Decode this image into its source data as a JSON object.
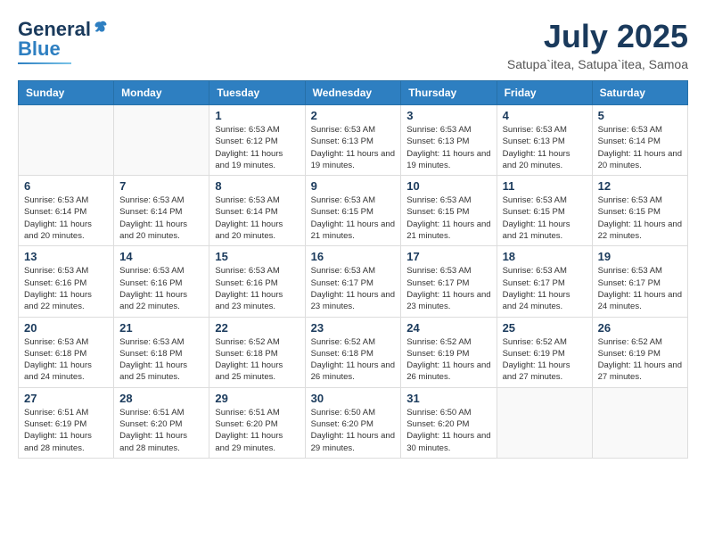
{
  "header": {
    "logo_general": "General",
    "logo_blue": "Blue",
    "month_title": "July 2025",
    "location": "Satupa`itea, Satupa`itea, Samoa"
  },
  "weekdays": [
    "Sunday",
    "Monday",
    "Tuesday",
    "Wednesday",
    "Thursday",
    "Friday",
    "Saturday"
  ],
  "weeks": [
    [
      {
        "day": "",
        "info": ""
      },
      {
        "day": "",
        "info": ""
      },
      {
        "day": "1",
        "info": "Sunrise: 6:53 AM\nSunset: 6:12 PM\nDaylight: 11 hours and 19 minutes."
      },
      {
        "day": "2",
        "info": "Sunrise: 6:53 AM\nSunset: 6:13 PM\nDaylight: 11 hours and 19 minutes."
      },
      {
        "day": "3",
        "info": "Sunrise: 6:53 AM\nSunset: 6:13 PM\nDaylight: 11 hours and 19 minutes."
      },
      {
        "day": "4",
        "info": "Sunrise: 6:53 AM\nSunset: 6:13 PM\nDaylight: 11 hours and 20 minutes."
      },
      {
        "day": "5",
        "info": "Sunrise: 6:53 AM\nSunset: 6:14 PM\nDaylight: 11 hours and 20 minutes."
      }
    ],
    [
      {
        "day": "6",
        "info": "Sunrise: 6:53 AM\nSunset: 6:14 PM\nDaylight: 11 hours and 20 minutes."
      },
      {
        "day": "7",
        "info": "Sunrise: 6:53 AM\nSunset: 6:14 PM\nDaylight: 11 hours and 20 minutes."
      },
      {
        "day": "8",
        "info": "Sunrise: 6:53 AM\nSunset: 6:14 PM\nDaylight: 11 hours and 20 minutes."
      },
      {
        "day": "9",
        "info": "Sunrise: 6:53 AM\nSunset: 6:15 PM\nDaylight: 11 hours and 21 minutes."
      },
      {
        "day": "10",
        "info": "Sunrise: 6:53 AM\nSunset: 6:15 PM\nDaylight: 11 hours and 21 minutes."
      },
      {
        "day": "11",
        "info": "Sunrise: 6:53 AM\nSunset: 6:15 PM\nDaylight: 11 hours and 21 minutes."
      },
      {
        "day": "12",
        "info": "Sunrise: 6:53 AM\nSunset: 6:15 PM\nDaylight: 11 hours and 22 minutes."
      }
    ],
    [
      {
        "day": "13",
        "info": "Sunrise: 6:53 AM\nSunset: 6:16 PM\nDaylight: 11 hours and 22 minutes."
      },
      {
        "day": "14",
        "info": "Sunrise: 6:53 AM\nSunset: 6:16 PM\nDaylight: 11 hours and 22 minutes."
      },
      {
        "day": "15",
        "info": "Sunrise: 6:53 AM\nSunset: 6:16 PM\nDaylight: 11 hours and 23 minutes."
      },
      {
        "day": "16",
        "info": "Sunrise: 6:53 AM\nSunset: 6:17 PM\nDaylight: 11 hours and 23 minutes."
      },
      {
        "day": "17",
        "info": "Sunrise: 6:53 AM\nSunset: 6:17 PM\nDaylight: 11 hours and 23 minutes."
      },
      {
        "day": "18",
        "info": "Sunrise: 6:53 AM\nSunset: 6:17 PM\nDaylight: 11 hours and 24 minutes."
      },
      {
        "day": "19",
        "info": "Sunrise: 6:53 AM\nSunset: 6:17 PM\nDaylight: 11 hours and 24 minutes."
      }
    ],
    [
      {
        "day": "20",
        "info": "Sunrise: 6:53 AM\nSunset: 6:18 PM\nDaylight: 11 hours and 24 minutes."
      },
      {
        "day": "21",
        "info": "Sunrise: 6:53 AM\nSunset: 6:18 PM\nDaylight: 11 hours and 25 minutes."
      },
      {
        "day": "22",
        "info": "Sunrise: 6:52 AM\nSunset: 6:18 PM\nDaylight: 11 hours and 25 minutes."
      },
      {
        "day": "23",
        "info": "Sunrise: 6:52 AM\nSunset: 6:18 PM\nDaylight: 11 hours and 26 minutes."
      },
      {
        "day": "24",
        "info": "Sunrise: 6:52 AM\nSunset: 6:19 PM\nDaylight: 11 hours and 26 minutes."
      },
      {
        "day": "25",
        "info": "Sunrise: 6:52 AM\nSunset: 6:19 PM\nDaylight: 11 hours and 27 minutes."
      },
      {
        "day": "26",
        "info": "Sunrise: 6:52 AM\nSunset: 6:19 PM\nDaylight: 11 hours and 27 minutes."
      }
    ],
    [
      {
        "day": "27",
        "info": "Sunrise: 6:51 AM\nSunset: 6:19 PM\nDaylight: 11 hours and 28 minutes."
      },
      {
        "day": "28",
        "info": "Sunrise: 6:51 AM\nSunset: 6:20 PM\nDaylight: 11 hours and 28 minutes."
      },
      {
        "day": "29",
        "info": "Sunrise: 6:51 AM\nSunset: 6:20 PM\nDaylight: 11 hours and 29 minutes."
      },
      {
        "day": "30",
        "info": "Sunrise: 6:50 AM\nSunset: 6:20 PM\nDaylight: 11 hours and 29 minutes."
      },
      {
        "day": "31",
        "info": "Sunrise: 6:50 AM\nSunset: 6:20 PM\nDaylight: 11 hours and 30 minutes."
      },
      {
        "day": "",
        "info": ""
      },
      {
        "day": "",
        "info": ""
      }
    ]
  ]
}
